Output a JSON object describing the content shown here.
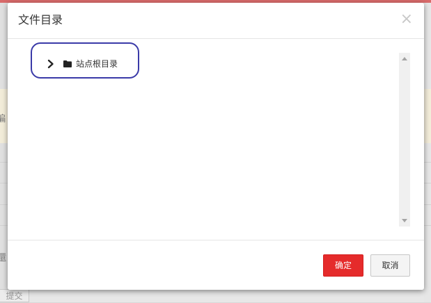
{
  "background": {
    "fragments": [
      "編",
      "還"
    ],
    "submit_label": "提交"
  },
  "dialog": {
    "title": "文件目录",
    "close_symbol": "×"
  },
  "tree": {
    "nodes": [
      {
        "label": "站点根目录",
        "expanded": false,
        "icon": "folder-icon"
      }
    ]
  },
  "footer": {
    "ok_label": "确定",
    "cancel_label": "取消"
  },
  "colors": {
    "primary": "#e52b2b",
    "highlight_ring": "#3a3aa8"
  }
}
